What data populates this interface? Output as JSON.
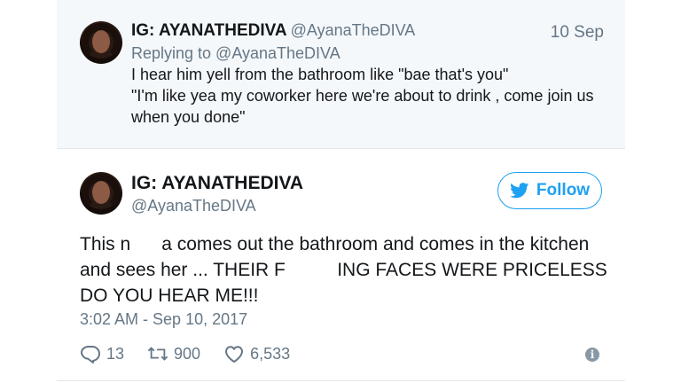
{
  "reply_tweet": {
    "display_name": "IG: AYANATHEDIVA",
    "handle": "@AyanaTheDIVA",
    "date": "10 Sep",
    "replying_to": "Replying to @AyanaTheDIVA",
    "lines": [
      "I hear him yell from the bathroom like \"bae that's you\"",
      "\"I'm like yea my coworker here we're about to drink , come join us",
      "when you done\""
    ]
  },
  "main_tweet": {
    "display_name": "IG: AYANATHEDIVA",
    "handle": "@AyanaTheDIVA",
    "follow_label": "Follow",
    "text_lines": [
      "This n      a comes out the bathroom and comes in the kitchen",
      "and sees her ... THEIR F          ING FACES WERE PRICELESS",
      "DO YOU HEAR ME!!!"
    ],
    "timestamp": "3:02 AM - Sep 10, 2017",
    "replies": "13",
    "retweets": "900",
    "likes": "6,533"
  },
  "colors": {
    "accent": "#1da1f2",
    "secondary_text": "#657786",
    "reply_background": "#f5f8fa"
  }
}
